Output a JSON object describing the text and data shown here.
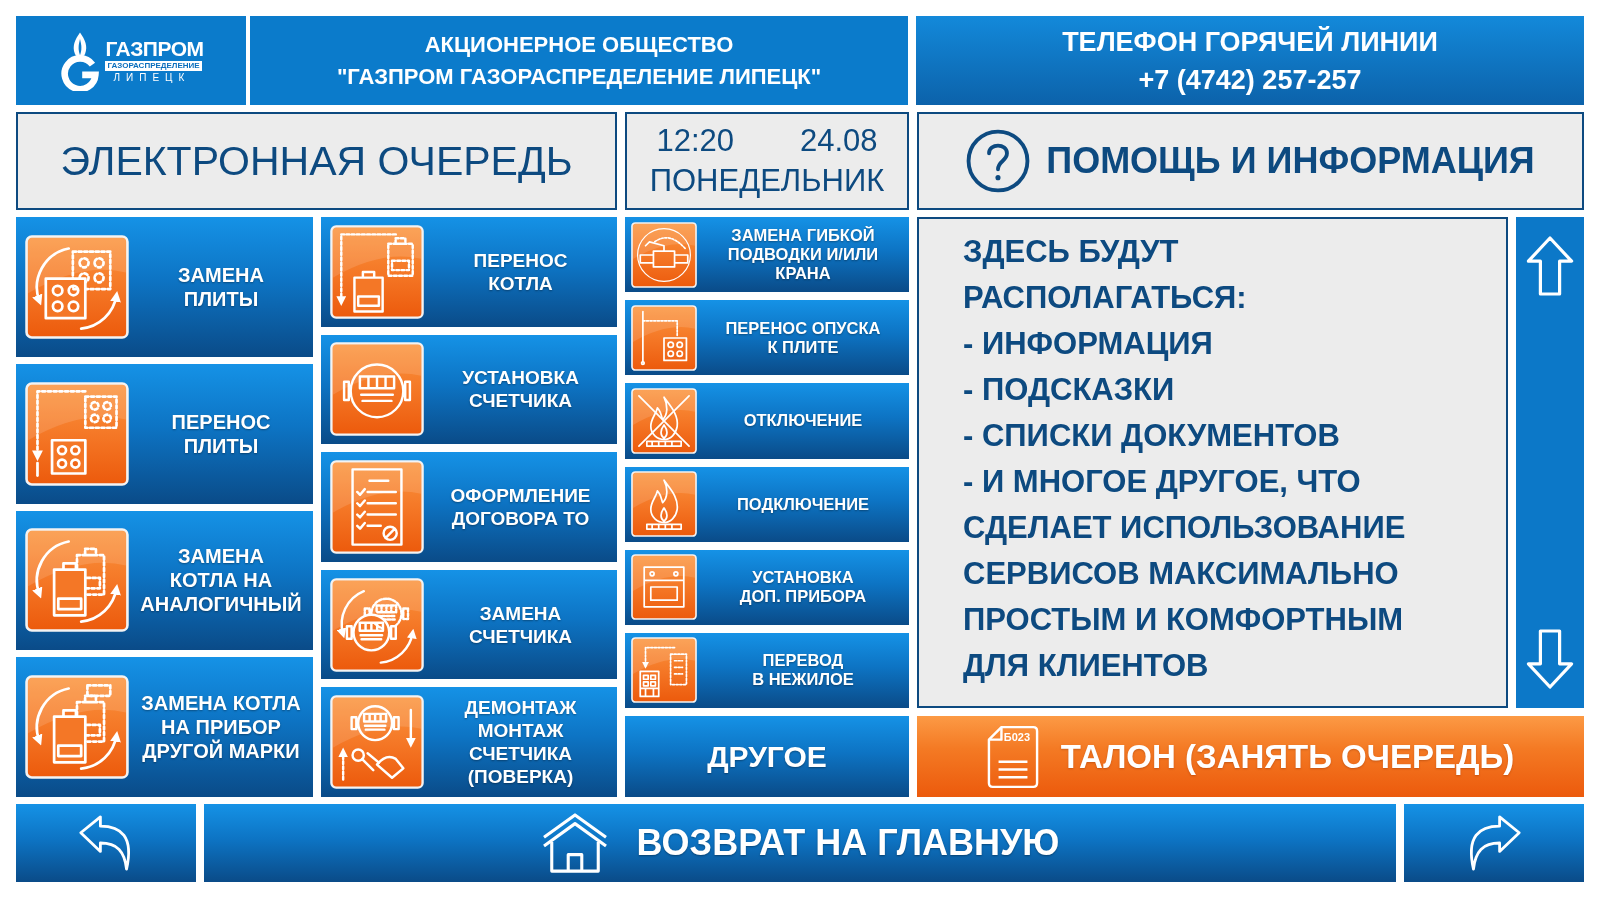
{
  "header": {
    "logo": {
      "wordmark": "ГАЗПРОМ",
      "subtitle": "ГАЗОРАСПРЕДЕЛЕНИЕ",
      "city": "ЛИПЕЦК"
    },
    "organization": "АКЦИОНЕРНОЕ ОБЩЕСТВО\n\"ГАЗПРОМ ГАЗОРАСПРЕДЕЛЕНИЕ ЛИПЕЦК\"",
    "hotline": {
      "title": "ТЕЛЕФОН ГОРЯЧЕЙ ЛИНИИ",
      "phone": "+7 (4742) 257-257"
    }
  },
  "queue_title": "ЭЛЕКТРОННАЯ ОЧЕРЕДЬ",
  "clock": {
    "time": "12:20",
    "date": "24.08",
    "weekday": "ПОНЕДЕЛЬНИК"
  },
  "help_title": "ПОМОЩЬ И ИНФОРМАЦИЯ",
  "services": {
    "column_1": [
      {
        "label": "ЗАМЕНА\nПЛИТЫ"
      },
      {
        "label": "ПЕРЕНОС\nПЛИТЫ"
      },
      {
        "label": "ЗАМЕНА\nКОТЛА НА\nАНАЛОГИЧНЫЙ"
      },
      {
        "label": "ЗАМЕНА КОТЛА\nНА ПРИБОР\nДРУГОЙ МАРКИ"
      }
    ],
    "column_2": [
      {
        "label": "ПЕРЕНОС\nКОТЛА"
      },
      {
        "label": "УСТАНОВКА\nСЧЕТЧИКА"
      },
      {
        "label": "ОФОРМЛЕНИЕ\nДОГОВОРА ТО"
      },
      {
        "label": "ЗАМЕНА\nСЧЕТЧИКА"
      },
      {
        "label": "ДЕМОНТАЖ\nМОНТАЖ\nСЧЕТЧИКА\n(ПОВЕРКА)"
      }
    ],
    "column_3": [
      {
        "kind": "icon",
        "label": "ЗАМЕНА ГИБКОЙ\nПОДВОДКИ И/ИЛИ\nКРАНА"
      },
      {
        "kind": "icon",
        "label": "ПЕРЕНОС ОПУСКА\nК ПЛИТЕ"
      },
      {
        "kind": "icon",
        "label": "ОТКЛЮЧЕНИЕ"
      },
      {
        "kind": "icon",
        "label": "ПОДКЛЮЧЕНИЕ"
      },
      {
        "kind": "icon",
        "label": "УСТАНОВКА\nДОП. ПРИБОРА"
      },
      {
        "kind": "icon",
        "label": "ПЕРЕВОД\nВ НЕЖИЛОЕ"
      },
      {
        "kind": "text",
        "label": "ДРУГОЕ"
      }
    ]
  },
  "info": {
    "intro": "ЗДЕСЬ БУДУТ\nРАСПОЛАГАТЬСЯ:",
    "items": [
      "- ИНФОРМАЦИЯ",
      "- ПОДСКАЗКИ",
      "- СПИСКИ ДОКУМЕНТОВ",
      "- И МНОГОЕ ДРУГОЕ, ЧТО\nСДЕЛАЕТ ИСПОЛЬЗОВАНИЕ\nСЕРВИСОВ МАКСИМАЛЬНО\nПРОСТЫМ И КОМФОРТНЫМ\nДЛЯ КЛИЕНТОВ"
    ]
  },
  "ticket_button": {
    "number": "Б023",
    "label": "ТАЛОН (ЗАНЯТЬ ОЧЕРЕДЬ)"
  },
  "home_button": "ВОЗВРАТ НА ГЛАВНУЮ"
}
